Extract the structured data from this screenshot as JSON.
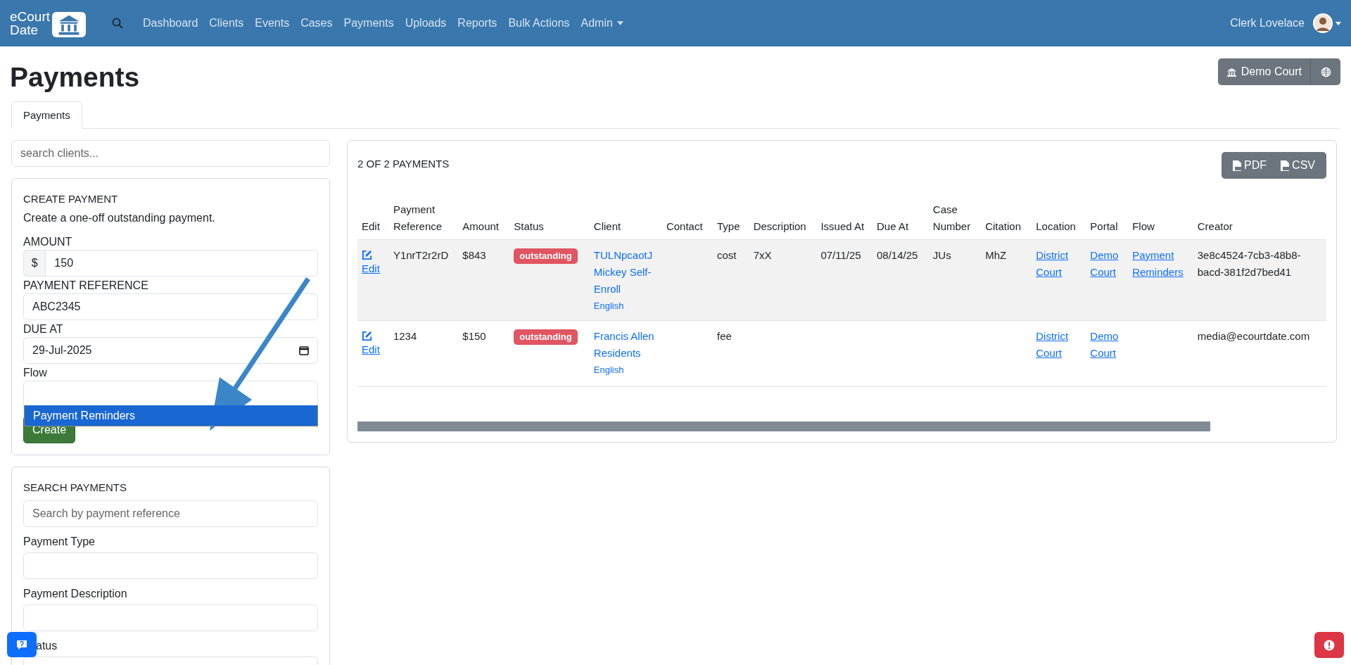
{
  "navbar": {
    "logo_text": [
      "eCourt",
      "Date"
    ],
    "links": [
      {
        "label": "Dashboard",
        "selected": false
      },
      {
        "label": "Clients",
        "selected": false
      },
      {
        "label": "Events",
        "selected": false
      },
      {
        "label": "Cases",
        "selected": false
      },
      {
        "label": "Payments",
        "selected": false
      },
      {
        "label": "Uploads",
        "selected": false
      },
      {
        "label": "Reports",
        "selected": false
      },
      {
        "label": "Bulk Actions",
        "selected": false
      },
      {
        "label": "Admin",
        "selected": false,
        "dropdown": true
      }
    ],
    "user": "Clerk Lovelace"
  },
  "page": {
    "title": "Payments",
    "court_button": "Demo Court"
  },
  "tabs": [
    {
      "label": "Payments",
      "selected": true
    }
  ],
  "client_search": {
    "placeholder": "search clients..."
  },
  "create_payment": {
    "heading": "CREATE PAYMENT",
    "description": "Create a one-off outstanding payment.",
    "amount_label": "AMOUNT",
    "currency": "$",
    "amount": "150",
    "reference_label": "PAYMENT REFERENCE",
    "reference": "ABC2345",
    "due_label": "DUE AT",
    "due": "29-Jul-2025",
    "flow_label": "Flow",
    "flow_options": [
      {
        "label": "Payment Reminders",
        "selected": true
      }
    ],
    "submit": "Create"
  },
  "search_payments": {
    "heading": "SEARCH PAYMENTS",
    "reference_placeholder": "Search by payment reference",
    "type_label": "Payment Type",
    "description_label": "Payment Description",
    "status_label": "atus"
  },
  "results": {
    "count": "2 OF 2 PAYMENTS",
    "exports": [
      "PDF",
      "CSV"
    ],
    "columns": [
      "Edit",
      "Payment Reference",
      "Amount",
      "Status",
      "Client",
      "Contact",
      "Type",
      "Description",
      "Issued At",
      "Due At",
      "Case Number",
      "Citation",
      "Location",
      "Portal",
      "Flow",
      "Creator"
    ],
    "rows": [
      {
        "edit": "Edit",
        "reference": "Y1nrT2r2rD",
        "amount": "$843",
        "status": "outstanding",
        "client": "TULNpcaotJ Mickey Self-Enroll",
        "language": "English",
        "contact": "",
        "type": "cost",
        "description": "7xX",
        "issued": "07/11/25",
        "due": "08/14/25",
        "case": "JUs",
        "citation": "MhZ",
        "location": "District Court",
        "portal": "Demo Court",
        "flow": "Payment Reminders",
        "creator": "3e8c4524-7cb3-48b8-bacd-381f2d7bed41",
        "selected": true
      },
      {
        "edit": "Edit",
        "reference": "1234",
        "amount": "$150",
        "status": "outstanding",
        "client": "Francis Allen Residents",
        "language": "English",
        "contact": "",
        "type": "fee",
        "description": "",
        "issued": "",
        "due": "",
        "case": "",
        "citation": "",
        "location": "District Court",
        "portal": "Demo Court",
        "flow": "",
        "creator": "media@ecourtdate.com",
        "selected": false
      }
    ]
  }
}
